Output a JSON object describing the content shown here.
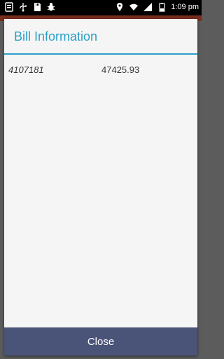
{
  "status_bar": {
    "time": "1:09",
    "time_suffix": "pm",
    "left_icons": [
      "notification-icon",
      "usb-icon",
      "sd-card-icon",
      "bug-icon"
    ],
    "right_icons": [
      "location-icon",
      "wifi-icon",
      "signal-icon",
      "battery-icon"
    ]
  },
  "dialog": {
    "title": "Bill Information",
    "rows": [
      {
        "id": "4107181",
        "amount": "47425.93"
      }
    ],
    "close_label": "Close"
  },
  "colors": {
    "accent": "#2aa0c8",
    "close_button": "#4a5378",
    "app_bar": "#7a2d1d"
  }
}
